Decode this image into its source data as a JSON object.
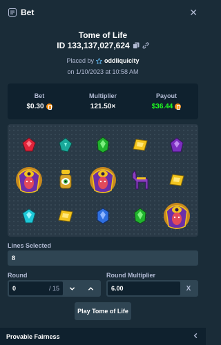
{
  "header": {
    "title": "Bet",
    "icon": "ticket-icon",
    "close_icon": "close-icon"
  },
  "bet": {
    "game": "Tome of Life",
    "id": "ID 133,137,027,624",
    "placed_by_label": "Placed by",
    "user": "oddliquicity",
    "placed_on": "on 1/10/2023 at 10:58 AM"
  },
  "stats": {
    "bet_label": "Bet",
    "bet_value": "$0.30",
    "multiplier_label": "Multiplier",
    "multiplier_value": "121.50×",
    "payout_label": "Payout",
    "payout_value": "$36.44"
  },
  "reels": [
    [
      "red-gem",
      "gem-diamond",
      "green-gem",
      "yellow-gem",
      "purple-gem"
    ],
    [
      "pharaoh",
      "eye-amulet",
      "pharaoh",
      "jackal",
      "yellow-gem"
    ],
    [
      "cyan-gem",
      "yellow-gem",
      "blue-gem",
      "green-gem",
      "pharaoh"
    ]
  ],
  "lines": {
    "label": "Lines Selected",
    "value": "8"
  },
  "round": {
    "label": "Round",
    "value": "0",
    "of": "/ 15"
  },
  "round_multiplier": {
    "label": "Round Multiplier",
    "value": "6.00",
    "clear": "X"
  },
  "play_button": "Play Tome of Life",
  "footer": {
    "label": "Provable Fairness"
  },
  "colors": {
    "bg": "#1a2c38",
    "panel": "#0f212e",
    "field": "#2f4553",
    "payout": "#1fff20"
  }
}
